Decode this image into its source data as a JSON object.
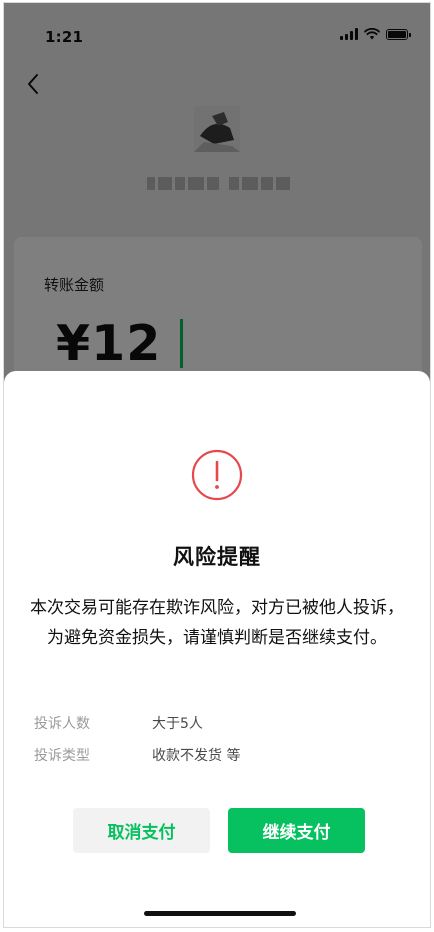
{
  "status_bar": {
    "time": "1:21",
    "signal_icon": "signal-bars-icon",
    "wifi_icon": "wifi-icon",
    "battery_icon": "battery-icon"
  },
  "header": {
    "back_icon": "chevron-left-icon"
  },
  "transfer": {
    "amount_label": "转账金额",
    "amount": "¥12"
  },
  "colors": {
    "accent": "#07c160",
    "warning": "#e5484d"
  },
  "dialog": {
    "icon": "exclamation-circle-icon",
    "title": "风险提醒",
    "message": "本次交易可能存在欺诈风险，对方已被他人投诉，为避免资金损失，请谨慎判断是否继续支付。",
    "details": [
      {
        "label": "投诉人数",
        "value": "大于5人"
      },
      {
        "label": "投诉类型",
        "value": "收款不发货 等"
      }
    ],
    "cancel_label": "取消支付",
    "continue_label": "继续支付"
  }
}
